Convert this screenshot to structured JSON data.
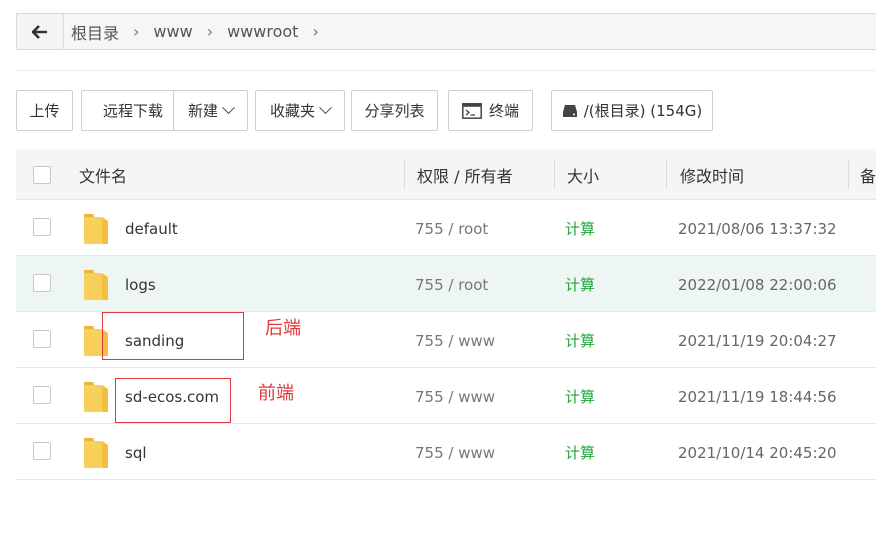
{
  "breadcrumb": [
    "根目录",
    "www",
    "wwwroot"
  ],
  "toolbar": {
    "upload": "上传",
    "remote_download": "远程下载",
    "new": "新建",
    "favorites": "收藏夹",
    "share_list": "分享列表",
    "terminal": "终端",
    "disk": "/(根目录) (154G)"
  },
  "table": {
    "headers": {
      "name": "文件名",
      "permission": "权限 / 所有者",
      "size": "大小",
      "modified": "修改时间",
      "remark": "备"
    },
    "rows": [
      {
        "name": "default",
        "permission": "755 / root",
        "size": "计算",
        "modified": "2021/08/06 13:37:32"
      },
      {
        "name": "logs",
        "permission": "755 / root",
        "size": "计算",
        "modified": "2022/01/08 22:00:06"
      },
      {
        "name": "sanding",
        "permission": "755 / www",
        "size": "计算",
        "modified": "2021/11/19 20:04:27"
      },
      {
        "name": "sd-ecos.com",
        "permission": "755 / www",
        "size": "计算",
        "modified": "2021/11/19 18:44:56"
      },
      {
        "name": "sql",
        "permission": "755 / www",
        "size": "计算",
        "modified": "2021/10/14 20:45:20"
      }
    ]
  },
  "annotations": {
    "backend": "后端",
    "frontend": "前端"
  },
  "colors": {
    "size_link": "#20a53a",
    "annotation": "#e0373b",
    "highlight_row": "#eef6f3",
    "folder": "#f7cf5b"
  }
}
